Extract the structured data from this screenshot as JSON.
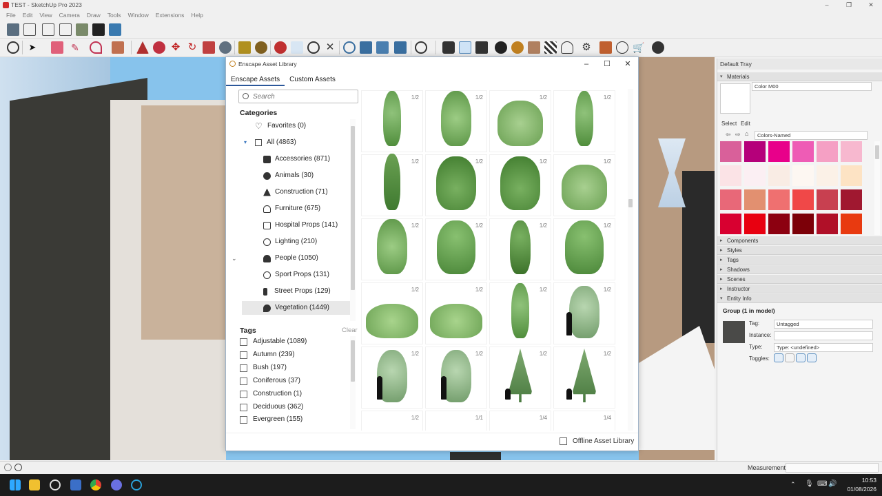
{
  "window": {
    "title": "TEST - SketchUp Pro 2023",
    "controls": [
      "–",
      "❐",
      "✕"
    ]
  },
  "menu": [
    "File",
    "Edit",
    "View",
    "Camera",
    "Draw",
    "Tools",
    "Window",
    "Extensions",
    "Help"
  ],
  "dialog": {
    "title": "Enscape Asset Library",
    "controls": [
      "–",
      "☐",
      "✕"
    ],
    "tabs": [
      "Enscape Assets",
      "Custom Assets"
    ],
    "search_placeholder": "Search",
    "categories_heading": "Categories",
    "favorites": "Favorites (0)",
    "all": "All (4863)",
    "categories": [
      {
        "label": "Accessories (871)",
        "icon": "lamp-icon"
      },
      {
        "label": "Animals (30)",
        "icon": "paw-icon"
      },
      {
        "label": "Construction (71)",
        "icon": "cone-icon"
      },
      {
        "label": "Furniture (675)",
        "icon": "chair-icon"
      },
      {
        "label": "Hospital Props (141)",
        "icon": "medical-icon"
      },
      {
        "label": "Lighting (210)",
        "icon": "bulb-icon"
      },
      {
        "label": "People (1050)",
        "icon": "people-icon"
      },
      {
        "label": "Sport Props (131)",
        "icon": "ball-icon"
      },
      {
        "label": "Street Props (129)",
        "icon": "street-light-icon"
      },
      {
        "label": "Vegetation (1449)",
        "icon": "leaf-icon"
      }
    ],
    "tags_heading": "Tags",
    "clear_label": "Clear",
    "tags": [
      "Adjustable (1089)",
      "Autumn (239)",
      "Bush (197)",
      "Coniferous (37)",
      "Construction (1)",
      "Deciduous (362)",
      "Evergreen (155)"
    ],
    "assets": [
      {
        "count": "1/2",
        "kind": "ivy-tall"
      },
      {
        "count": "1/2",
        "kind": "ivy-wall"
      },
      {
        "count": "1/2",
        "kind": "ivy-square"
      },
      {
        "count": "1/2",
        "kind": "ivy-tall"
      },
      {
        "count": "1/2",
        "kind": "vine-tall"
      },
      {
        "count": "1/2",
        "kind": "vine-bush"
      },
      {
        "count": "1/2",
        "kind": "vine-bush"
      },
      {
        "count": "1/2",
        "kind": "ivy-square"
      },
      {
        "count": "1/2",
        "kind": "ivy-wall"
      },
      {
        "count": "1/2",
        "kind": "hanging"
      },
      {
        "count": "1/2",
        "kind": "hanging-narrow"
      },
      {
        "count": "1/2",
        "kind": "hanging"
      },
      {
        "count": "1/2",
        "kind": "creeper"
      },
      {
        "count": "1/2",
        "kind": "creeper"
      },
      {
        "count": "1/2",
        "kind": "ivy-tall"
      },
      {
        "count": "1/2",
        "kind": "tree-person"
      },
      {
        "count": "1/2",
        "kind": "tree-person"
      },
      {
        "count": "1/2",
        "kind": "tree-person"
      },
      {
        "count": "1/2",
        "kind": "conifer-person"
      },
      {
        "count": "1/2",
        "kind": "conifer-person"
      },
      {
        "count": "1/2",
        "kind": "shrub"
      },
      {
        "count": "1/1",
        "kind": "shrub"
      },
      {
        "count": "1/4",
        "kind": "shrub"
      },
      {
        "count": "1/4",
        "kind": "shrub"
      }
    ],
    "offline_label": "Offline Asset Library"
  },
  "tray": {
    "title": "Default Tray",
    "materials_heading": "Materials",
    "material_name": "Color M00",
    "select_tab": "Select",
    "edit_tab": "Edit",
    "library": "Colors-Named",
    "swatches": [
      "#d9609a",
      "#b5007a",
      "#e8008a",
      "#ee5cb5",
      "#f5a0c4",
      "#f7b8cf",
      "#fbe3e6",
      "#fbeff3",
      "#f9ece4",
      "#fdf7f2",
      "#fbf1e7",
      "#fde3c4",
      "#e86878",
      "#e29070",
      "#ef7070",
      "#f04848",
      "#c84050",
      "#a01830",
      "#d80030",
      "#e80010",
      "#8c0010",
      "#7c0008",
      "#b01028",
      "#e83a10"
    ],
    "sections": [
      "Components",
      "Styles",
      "Tags",
      "Shadows",
      "Scenes",
      "Instructor"
    ],
    "entity_heading": "Entity Info",
    "entity_title": "Group (1 in model)",
    "tag_label": "Tag:",
    "tag_value": "Untagged",
    "instance_label": "Instance:",
    "type_label": "Type:",
    "type_value": "Type: <undefined>",
    "toggles_label": "Toggles:"
  },
  "status": {
    "measurements": "Measurements"
  },
  "taskbar": {
    "time": "10:53",
    "date": "01/08/2026"
  }
}
